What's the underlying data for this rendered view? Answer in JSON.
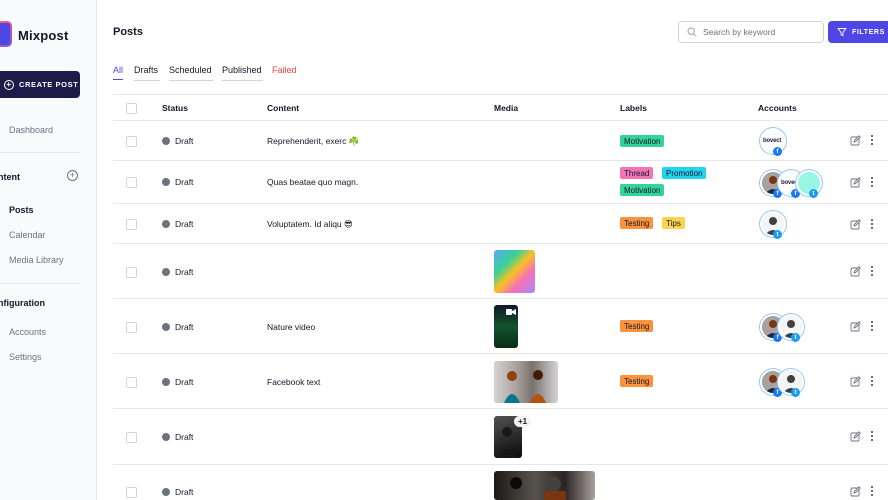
{
  "app": {
    "name": "Mixpost"
  },
  "sidebar": {
    "create_label": "CREATE POST",
    "items": [
      {
        "label": "Dashboard"
      },
      {
        "label": "ntent"
      },
      {
        "label": "Posts"
      },
      {
        "label": "Calendar"
      },
      {
        "label": "Media Library"
      },
      {
        "label": "nfiguration"
      },
      {
        "label": "Accounts"
      },
      {
        "label": "Settings"
      }
    ]
  },
  "header": {
    "title": "Posts",
    "search_placeholder": "Search by keyword",
    "filters_label": "FILTERS"
  },
  "tabs": [
    {
      "label": "All"
    },
    {
      "label": "Drafts"
    },
    {
      "label": "Scheduled"
    },
    {
      "label": "Published"
    },
    {
      "label": "Failed"
    }
  ],
  "table": {
    "columns": [
      "Status",
      "Content",
      "Media",
      "Labels",
      "Accounts"
    ],
    "rows": [
      {
        "status": "Draft",
        "content": "Reprehenderit, exerc ☘️",
        "labels": [
          {
            "name": "Motivation",
            "color": "#34d399"
          }
        ]
      },
      {
        "status": "Draft",
        "content": "Quas beatae quo magn.",
        "labels": [
          {
            "name": "Thread",
            "color": "#f472b6"
          },
          {
            "name": "Promotion",
            "color": "#22d3ee"
          },
          {
            "name": "Motivation",
            "color": "#34d399"
          }
        ]
      },
      {
        "status": "Draft",
        "content": "Voluptatem. Id aliqu 😎",
        "labels": [
          {
            "name": "Testing",
            "color": "#fb923c"
          },
          {
            "name": "Tips",
            "color": "#fcd34d"
          }
        ]
      },
      {
        "status": "Draft",
        "content": "",
        "labels": []
      },
      {
        "status": "Draft",
        "content": "Nature video",
        "labels": [
          {
            "name": "Testing",
            "color": "#fb923c"
          }
        ]
      },
      {
        "status": "Draft",
        "content": "Facebook text",
        "labels": [
          {
            "name": "Testing",
            "color": "#fb923c"
          }
        ]
      },
      {
        "status": "Draft",
        "content": "",
        "labels": [],
        "media_more": "+1"
      },
      {
        "status": "Draft",
        "content": "",
        "labels": []
      }
    ]
  },
  "avatar_brand_text": "bovect",
  "colors": {
    "accent": "#4f46e5",
    "sidebar_button": "#1e1b4b",
    "failed": "#ef4444",
    "facebook": "#1877f2",
    "twitter": "#1d9bf0"
  }
}
